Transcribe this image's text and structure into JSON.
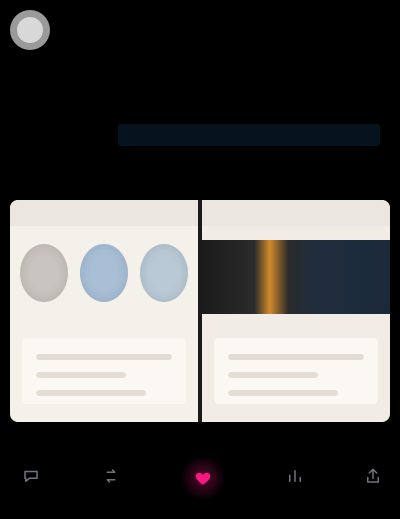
{
  "colors": {
    "background": "#000000",
    "text": "#e7e9ea",
    "muted": "#6e767d",
    "link": "#1d9bf0",
    "like": "#f91880"
  },
  "header": {
    "handle": ""
  },
  "tweet": {
    "text": "",
    "link": "",
    "meta_label": ""
  },
  "media": {
    "left_panel": {
      "description": ""
    },
    "right_panel": {
      "description": ""
    }
  },
  "actions": {
    "reply": {
      "icon": "reply-icon",
      "count": ""
    },
    "retweet": {
      "icon": "retweet-icon",
      "count": ""
    },
    "like": {
      "icon": "heart-icon",
      "count": ""
    },
    "views": {
      "icon": "views-icon",
      "count": ""
    },
    "share": {
      "icon": "share-icon",
      "count": ""
    }
  }
}
